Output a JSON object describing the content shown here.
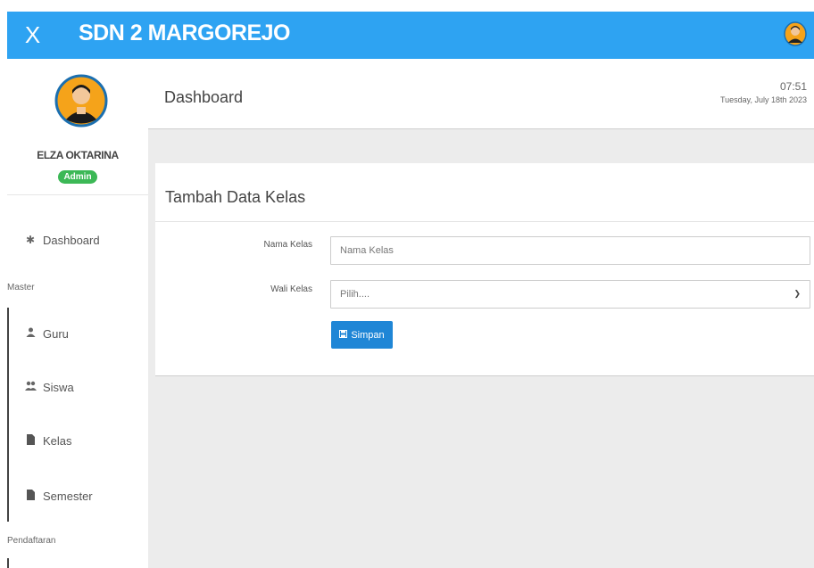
{
  "topbar": {
    "close_glyph": "X",
    "title": "SDN 2 MARGOREJO"
  },
  "sidebar": {
    "user_name": "ELZA OKTARINA",
    "role": "Admin",
    "items": [
      {
        "label": "Dashboard",
        "icon": "home-icon"
      },
      {
        "label": "Guru",
        "icon": "user-icon"
      },
      {
        "label": "Siswa",
        "icon": "users-icon"
      },
      {
        "label": "Kelas",
        "icon": "file-icon"
      },
      {
        "label": "Semester",
        "icon": "file-icon"
      }
    ],
    "sections": [
      "Master",
      "Pendaftaran"
    ]
  },
  "header": {
    "title": "Dashboard",
    "time": "07:51",
    "date": "Tuesday, July 18th 2023"
  },
  "form": {
    "title": "Tambah Data Kelas",
    "nama_label": "Nama Kelas",
    "nama_placeholder": "Nama Kelas",
    "wali_label": "Wali Kelas",
    "wali_selected": "Pilih....",
    "save_label": "Simpan"
  },
  "colors": {
    "topbar": "#2ea3f2",
    "badge": "#3cb856",
    "button": "#1f86d6"
  }
}
